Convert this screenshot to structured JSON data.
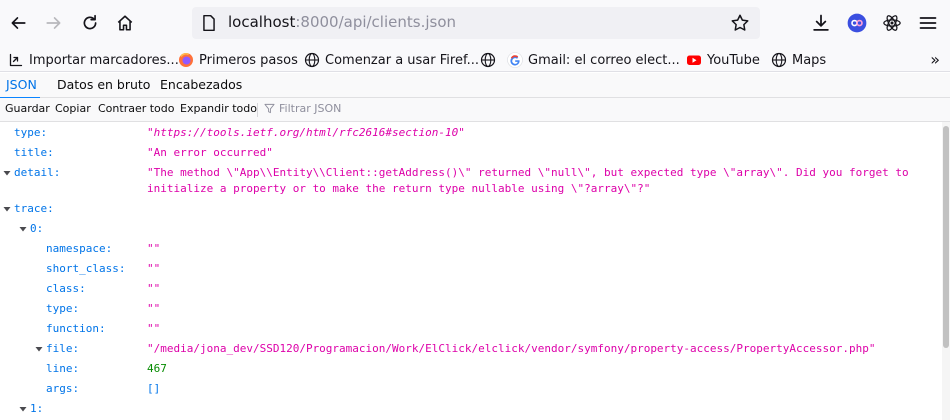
{
  "browser": {
    "url_host": "localhost",
    "url_rest": ":8000/api/clients.json",
    "bookmarks": [
      {
        "label": "Importar marcadores...",
        "icon": "import-icon"
      },
      {
        "label": "Primeros pasos",
        "icon": "firefox-icon"
      },
      {
        "label": "Comenzar a usar Firef...",
        "icon": "globe-icon"
      },
      {
        "label": "",
        "icon": "globe-icon"
      },
      {
        "label": "Gmail: el correo elect...",
        "icon": "google-icon"
      },
      {
        "label": "YouTube",
        "icon": "youtube-icon"
      },
      {
        "label": "Maps",
        "icon": "globe-icon"
      }
    ],
    "overflow_glyph": "»"
  },
  "viewer": {
    "tabs": [
      "JSON",
      "Datos en bruto",
      "Encabezados"
    ],
    "selected_tab": "JSON",
    "toolbar": {
      "save": "Guardar",
      "copy": "Copiar",
      "collapse_all": "Contraer todo",
      "expand_all": "Expandir todo",
      "filter_placeholder": "Filtrar JSON"
    }
  },
  "json": {
    "type_key": "type:",
    "type_val": "\"https://tools.ietf.org/html/rfc2616#section-10\"",
    "title_key": "title:",
    "title_val": "\"An error occurred\"",
    "detail_key": "detail:",
    "detail_val": "\"The method \\\"App\\\\Entity\\\\Client::getAddress()\\\" returned \\\"null\\\", but expected type \\\"array\\\". Did you forget to initialize a property or to make the return type nullable using \\\"?array\\\"?\"",
    "trace_key": "trace:",
    "trace0_key": "0:",
    "namespace_key": "namespace:",
    "namespace_val": "\"\"",
    "short_class_key": "short_class:",
    "short_class_val": "\"\"",
    "class_key": "class:",
    "class_val": "\"\"",
    "type2_key": "type:",
    "type2_val": "\"\"",
    "function_key": "function:",
    "function_val": "\"\"",
    "file_key": "file:",
    "file_val": "\"/media/jona_dev/SSD120/Programacion/Work/ElClick/elclick/vendor/symfony/property-access/PropertyAccessor.php\"",
    "line_key": "line:",
    "line_val": "467",
    "args_key": "args:",
    "args_val": "[]",
    "trace1_key": "1:"
  },
  "colors": {
    "key": "#0074e8",
    "string": "#dd00a9",
    "number": "#058b00",
    "tab_accent": "#0a84ff"
  }
}
